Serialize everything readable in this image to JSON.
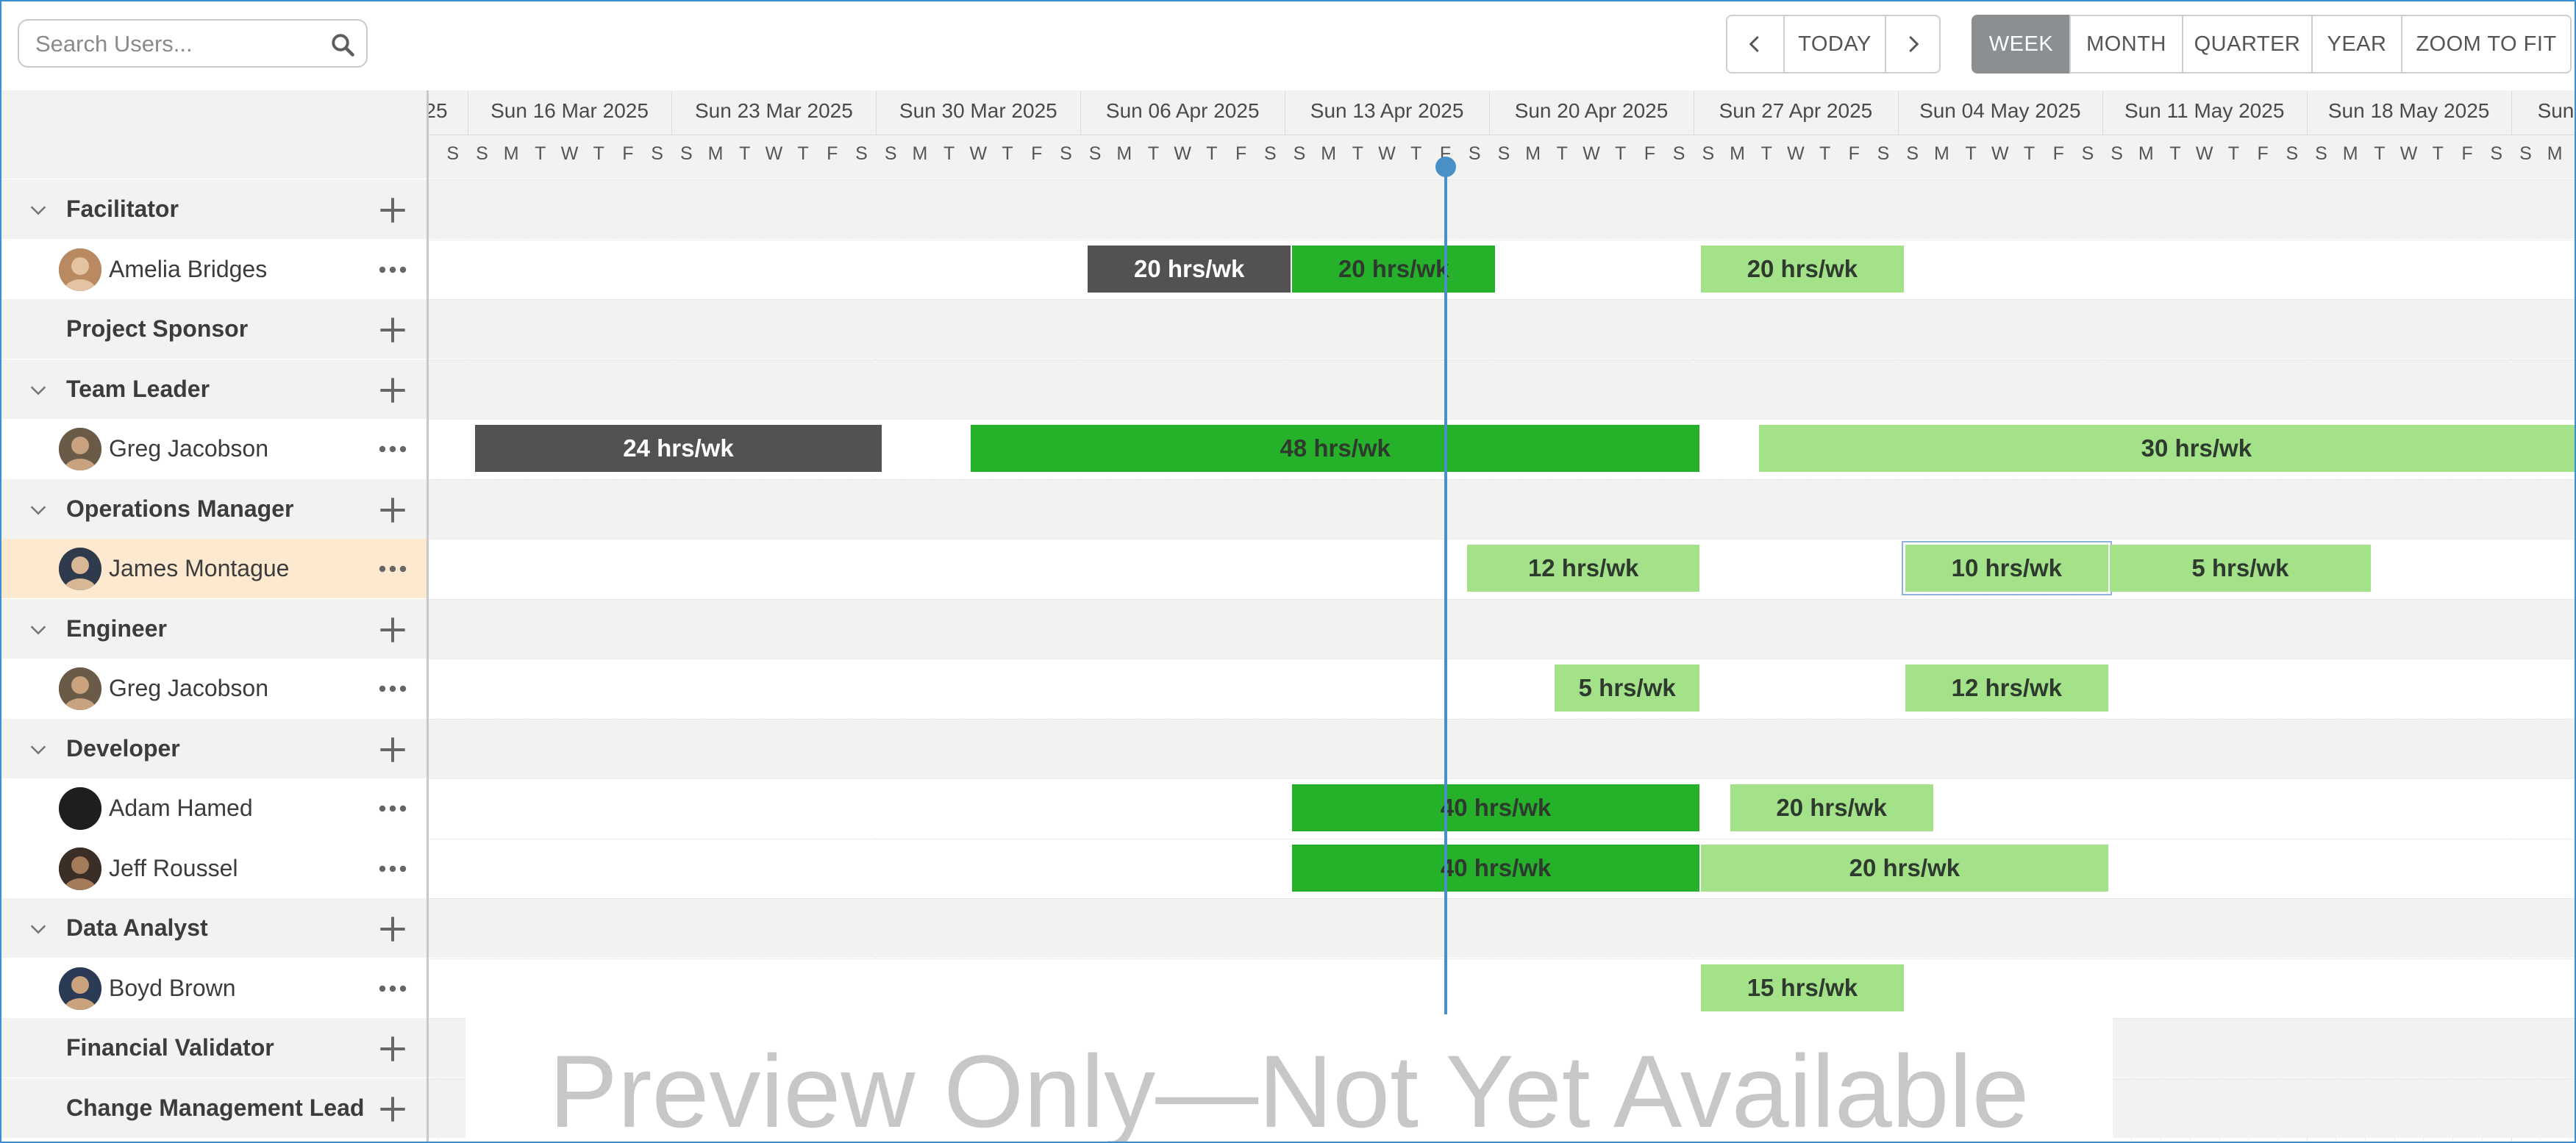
{
  "search": {
    "placeholder": "Search Users..."
  },
  "nav": {
    "prev": "previous-icon",
    "today": "TODAY",
    "next": "next-icon"
  },
  "views": {
    "week": "WEEK",
    "month": "MONTH",
    "quarter": "QUARTER",
    "year": "YEAR",
    "zoom": "ZOOM TO FIT",
    "active": "WEEK"
  },
  "timeline": {
    "first_visible_label_fragment": "25",
    "weeks": [
      "Sun 16 Mar 2025",
      "Sun 23 Mar 2025",
      "Sun 30 Mar 2025",
      "Sun 06 Apr 2025",
      "Sun 13 Apr 2025",
      "Sun 20 Apr 2025",
      "Sun 27 Apr 2025",
      "Sun 04 May 2025",
      "Sun 11 May 2025",
      "Sun 18 May 2025",
      "Sun"
    ],
    "day_letters": [
      "S",
      "M",
      "T",
      "W",
      "T",
      "F",
      "S"
    ],
    "today": "2025-04-18"
  },
  "rows": [
    {
      "type": "group",
      "title": "Facilitator",
      "collapsible": true
    },
    {
      "type": "user",
      "name": "Amelia Bridges",
      "avatar": "avatar-amelia",
      "bars": [
        {
          "start": "2025-04-06",
          "end": "2025-04-12",
          "label": "20 hrs/wk",
          "style": "past"
        },
        {
          "start": "2025-04-13",
          "end": "2025-04-19",
          "label": "20 hrs/wk",
          "style": "current"
        },
        {
          "start": "2025-04-27",
          "end": "2025-05-03",
          "label": "20 hrs/wk",
          "style": "future"
        }
      ]
    },
    {
      "type": "group",
      "title": "Project Sponsor",
      "collapsible": false
    },
    {
      "type": "group",
      "title": "Team Leader",
      "collapsible": true
    },
    {
      "type": "user",
      "name": "Greg Jacobson",
      "avatar": "avatar-greg",
      "bars": [
        {
          "start": "2025-03-16",
          "end": "2025-03-29",
          "label": "24 hrs/wk",
          "style": "past"
        },
        {
          "start": "2025-04-02",
          "end": "2025-04-26",
          "label": "48 hrs/wk",
          "style": "current"
        },
        {
          "start": "2025-04-29",
          "end": "2025-05-28",
          "label": "30 hrs/wk",
          "style": "future"
        }
      ]
    },
    {
      "type": "group",
      "title": "Operations Manager",
      "collapsible": true
    },
    {
      "type": "user",
      "name": "James Montague",
      "avatar": "avatar-james",
      "selected": true,
      "bars": [
        {
          "start": "2025-04-19",
          "end": "2025-04-26",
          "label": "12 hrs/wk",
          "style": "future"
        },
        {
          "start": "2025-05-04",
          "end": "2025-05-10",
          "label": "10 hrs/wk",
          "style": "future",
          "outlined": true
        },
        {
          "start": "2025-05-11",
          "end": "2025-05-19",
          "label": "5 hrs/wk",
          "style": "future"
        }
      ]
    },
    {
      "type": "group",
      "title": "Engineer",
      "collapsible": true
    },
    {
      "type": "user",
      "name": "Greg Jacobson",
      "avatar": "avatar-greg",
      "bars": [
        {
          "start": "2025-04-22",
          "end": "2025-04-26",
          "label": "5 hrs/wk",
          "style": "future"
        },
        {
          "start": "2025-05-04",
          "end": "2025-05-10",
          "label": "12 hrs/wk",
          "style": "future"
        }
      ]
    },
    {
      "type": "group",
      "title": "Developer",
      "collapsible": true
    },
    {
      "type": "user",
      "name": "Adam Hamed",
      "avatar": "avatar-adam",
      "bars": [
        {
          "start": "2025-04-13",
          "end": "2025-04-26",
          "label": "40 hrs/wk",
          "style": "current"
        },
        {
          "start": "2025-04-28",
          "end": "2025-05-04",
          "label": "20 hrs/wk",
          "style": "future"
        }
      ]
    },
    {
      "type": "user",
      "name": "Jeff Roussel",
      "avatar": "avatar-jeff",
      "bars": [
        {
          "start": "2025-04-13",
          "end": "2025-04-26",
          "label": "40 hrs/wk",
          "style": "current"
        },
        {
          "start": "2025-04-27",
          "end": "2025-05-10",
          "label": "20 hrs/wk",
          "style": "future"
        }
      ]
    },
    {
      "type": "group",
      "title": "Data Analyst",
      "collapsible": true
    },
    {
      "type": "user",
      "name": "Boyd Brown",
      "avatar": "avatar-boyd",
      "bars": [
        {
          "start": "2025-04-27",
          "end": "2025-05-03",
          "label": "15 hrs/wk",
          "style": "future"
        }
      ]
    },
    {
      "type": "group",
      "title": "Financial Validator",
      "collapsible": false
    },
    {
      "type": "group",
      "title": "Change Management Lead",
      "collapsible": false
    }
  ],
  "colors": {
    "past": "#525252",
    "current": "#25b22a",
    "future": "#a3e289",
    "today_line": "#4a90c8",
    "selected_row": "#fde9cf",
    "group_row": "#f2f2f1"
  },
  "watermark": "Preview Only—Not Yet Available"
}
